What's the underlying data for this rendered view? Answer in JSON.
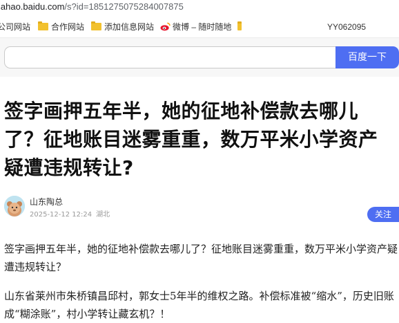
{
  "browser": {
    "url_host": "iahao.baidu.com",
    "url_path": "/s?id=1851275075284007875",
    "bookmarks": [
      "公司网站",
      "合作网站",
      "添加信息网站",
      "微博 – 随时随地"
    ],
    "user_label": "YY062095"
  },
  "search": {
    "placeholder": "",
    "button_label": "百度一下"
  },
  "article": {
    "title": "签字画押五年半，她的征地补偿款去哪儿了？征地账目迷雾重重，数万平米小学资产疑遭违规转让?",
    "author": "山东陶总",
    "date": "2025-12-12 12:24",
    "location": "湖北",
    "follow_label": "关注",
    "paragraphs": [
      "签字画押五年半，她的征地补偿款去哪儿了？征地账目迷雾重重，数万平米小学资产疑遭违规转让？",
      "山东省莱州市朱桥镇昌邱村，郭女士5年半的维权之路。补偿标准被“缩水”，历史旧账成“糊涂账”，村小学转让藏玄机？！"
    ]
  },
  "colors": {
    "accent": "#4e6ef2",
    "folder": "#f2c12e"
  }
}
